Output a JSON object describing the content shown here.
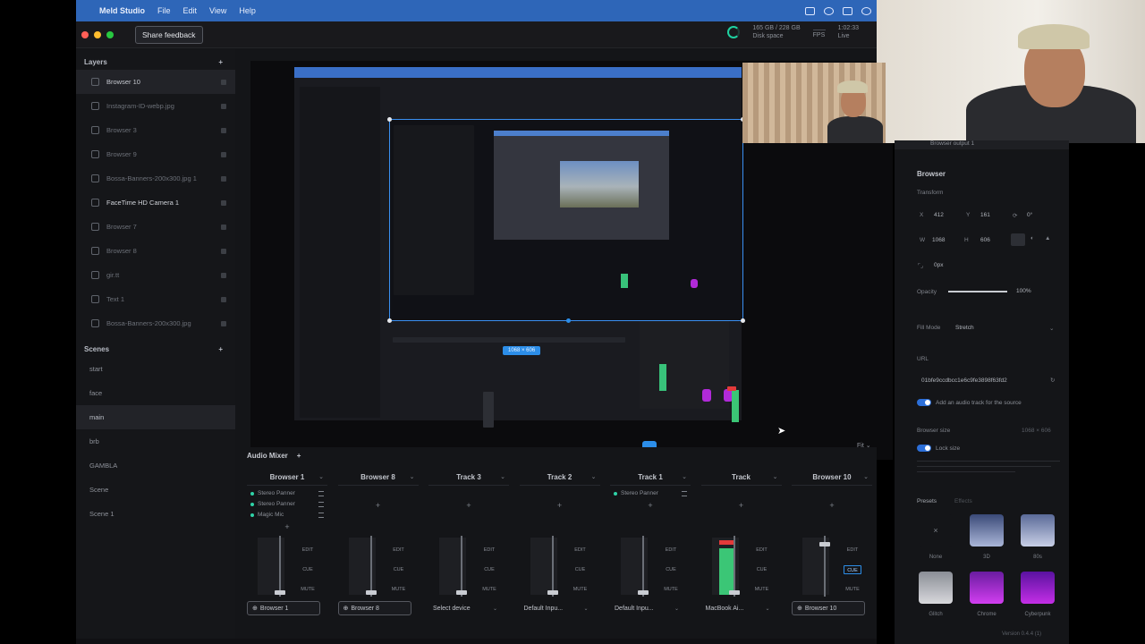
{
  "menubar": {
    "app_name": "Meld Studio",
    "items": [
      "File",
      "Edit",
      "View",
      "Help"
    ]
  },
  "titlebar": {
    "feedback_label": "Share feedback",
    "disk": "165 GB / 228 GB",
    "disk_label": "Disk space",
    "fps_label": "FPS",
    "live_value": "1:02:33",
    "live_label": "Live"
  },
  "layers": {
    "title": "Layers",
    "items": [
      {
        "label": "Browser 10"
      },
      {
        "label": "Instagram-ID-webp.jpg"
      },
      {
        "label": "Browser 3"
      },
      {
        "label": "Browser 9"
      },
      {
        "label": "Bossa-Banners-200x300.jpg 1"
      },
      {
        "label": "FaceTime HD Camera 1"
      },
      {
        "label": "Browser 7"
      },
      {
        "label": "Browser 8"
      },
      {
        "label": "gir.tt"
      },
      {
        "label": "Text 1"
      },
      {
        "label": "Bossa-Banners-200x300.jpg"
      }
    ]
  },
  "scenes": {
    "title": "Scenes",
    "items": [
      "start",
      "face",
      "main",
      "brb",
      "GAMBLA",
      "Scene",
      "Scene 1"
    ]
  },
  "preview": {
    "selection_tag": "1068 × 606",
    "fit_label": "Fit"
  },
  "mixer": {
    "title": "Audio Mixer",
    "strips": [
      {
        "name": "Browser 1",
        "effects": [
          "Stereo Panner",
          "Stereo Panner",
          "Magic Mic"
        ],
        "device": "Browser 1"
      },
      {
        "name": "Browser 8",
        "effects": [],
        "device": "Browser 8"
      },
      {
        "name": "Track 3",
        "effects": [],
        "device": "Select device"
      },
      {
        "name": "Track 2",
        "effects": [],
        "device": "Default Inpu..."
      },
      {
        "name": "Track 1",
        "effects": [
          "Stereo Panner"
        ],
        "device": "Default Inpu..."
      },
      {
        "name": "Track",
        "effects": [],
        "device": "MacBook Ai..."
      },
      {
        "name": "Browser 10",
        "effects": [],
        "device": "Browser 10"
      }
    ],
    "btn_edit": "EDIT",
    "btn_cue": "CUE",
    "btn_mute": "MUTE"
  },
  "props": {
    "header": "Browser output 1",
    "title": "Browser",
    "transform_label": "Transform",
    "x_label": "X",
    "x_value": "412",
    "y_label": "Y",
    "y_value": "161",
    "rot_value": "0°",
    "w_label": "W",
    "w_value": "1068",
    "h_label": "H",
    "h_value": "606",
    "corner_value": "0px",
    "opacity_label": "Opacity",
    "opacity_value": "100%",
    "fill_mode_label": "Fill Mode",
    "fill_mode_value": "Stretch",
    "url_label": "URL",
    "url_value": "01bfe9ccdbcc1e6c9fe3898f63fd2",
    "audio_track_label": "Add an audio track for the source",
    "browser_size_label": "Browser size",
    "browser_size_value": "1068 × 606",
    "lock_label": "Lock size",
    "presets_label": "Presets",
    "presets_tab2": "Effects",
    "presets": [
      "None",
      "3D",
      "80s",
      "Glitch",
      "Chrome",
      "Cyberpunk"
    ]
  },
  "version": "Version 0.4.4 (1)",
  "colors": {
    "accent": "#2c8ee9",
    "live": "#1fd1a0",
    "menubar": "#2e66b8"
  }
}
